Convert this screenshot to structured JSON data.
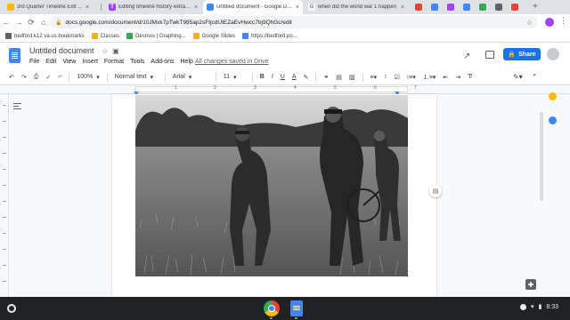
{
  "browser": {
    "tabs": [
      {
        "title": "3rd Quarter Timeline Extra Credit",
        "fav_color": "#fbbc04",
        "fav_glyph": ""
      },
      {
        "title": "Editing timeline history extra cre",
        "fav_color": "#a142f4",
        "fav_glyph": "T"
      },
      {
        "title": "Untitled document - Google Docs",
        "fav_color": "#4285f4",
        "fav_glyph": ""
      },
      {
        "title": "when did the world war 1 happen",
        "fav_color": "#ffffff",
        "fav_glyph": "G"
      }
    ],
    "close_glyph": "×",
    "newtab_glyph": "+",
    "url": "docs.google.com/document/d/10JMxk7pTwkT985ap2sFtjcdUtEZaEvHwcc7bj9QhGc/edit",
    "nav": {
      "back": "←",
      "forward": "→",
      "reload": "⟳",
      "home": "⌂"
    },
    "bookmarks": [
      {
        "label": "bedford k12 va.us bookmarks",
        "color": "#5f6368"
      },
      {
        "label": "Classes",
        "color": "#f4b400"
      },
      {
        "label": "Desmos | Graphing...",
        "color": "#34a853"
      },
      {
        "label": "Google Slides",
        "color": "#f4b400"
      },
      {
        "label": "https://bedford.po...",
        "color": "#4285f4"
      }
    ]
  },
  "docs": {
    "title": "Untitled document",
    "menu": [
      "File",
      "Edit",
      "View",
      "Insert",
      "Format",
      "Tools",
      "Add-ons",
      "Help"
    ],
    "saved_status": "All changes saved in Drive",
    "share_label": "Share",
    "toolbar": {
      "zoom": "100%",
      "style": "Normal text",
      "font": "Arial",
      "size": "11",
      "bold": "B",
      "italic": "I",
      "underline": "U",
      "text_color": "A"
    },
    "ruler_numbers": [
      "1",
      "2",
      "3",
      "4",
      "5",
      "6",
      "7"
    ]
  },
  "shelf": {
    "time": "8:33"
  },
  "colors": {
    "accent": "#1a73e8",
    "shelf": "#202124"
  }
}
